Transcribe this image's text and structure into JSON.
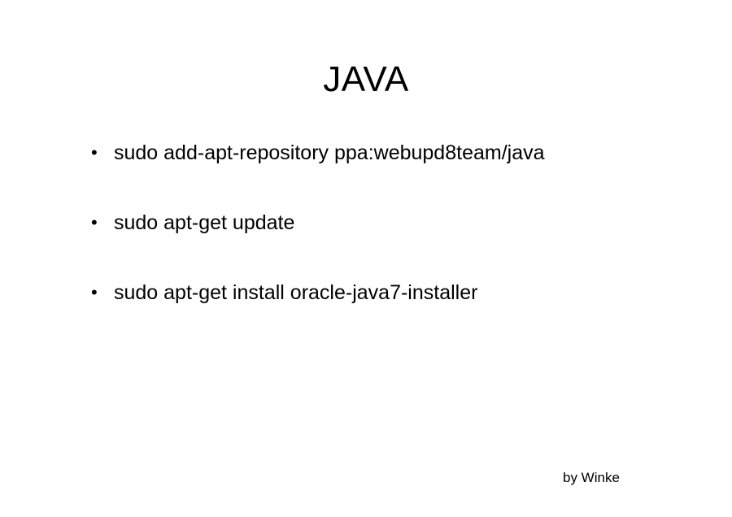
{
  "slide": {
    "title": "JAVA",
    "bullets": [
      {
        "marker": "•",
        "text": "sudo add-apt-repository ppa:webupd8team/java"
      },
      {
        "marker": "•",
        "text": "sudo apt-get update"
      },
      {
        "marker": "•",
        "text": "sudo apt-get install oracle-java7-installer"
      }
    ],
    "credit": "by Winke"
  }
}
